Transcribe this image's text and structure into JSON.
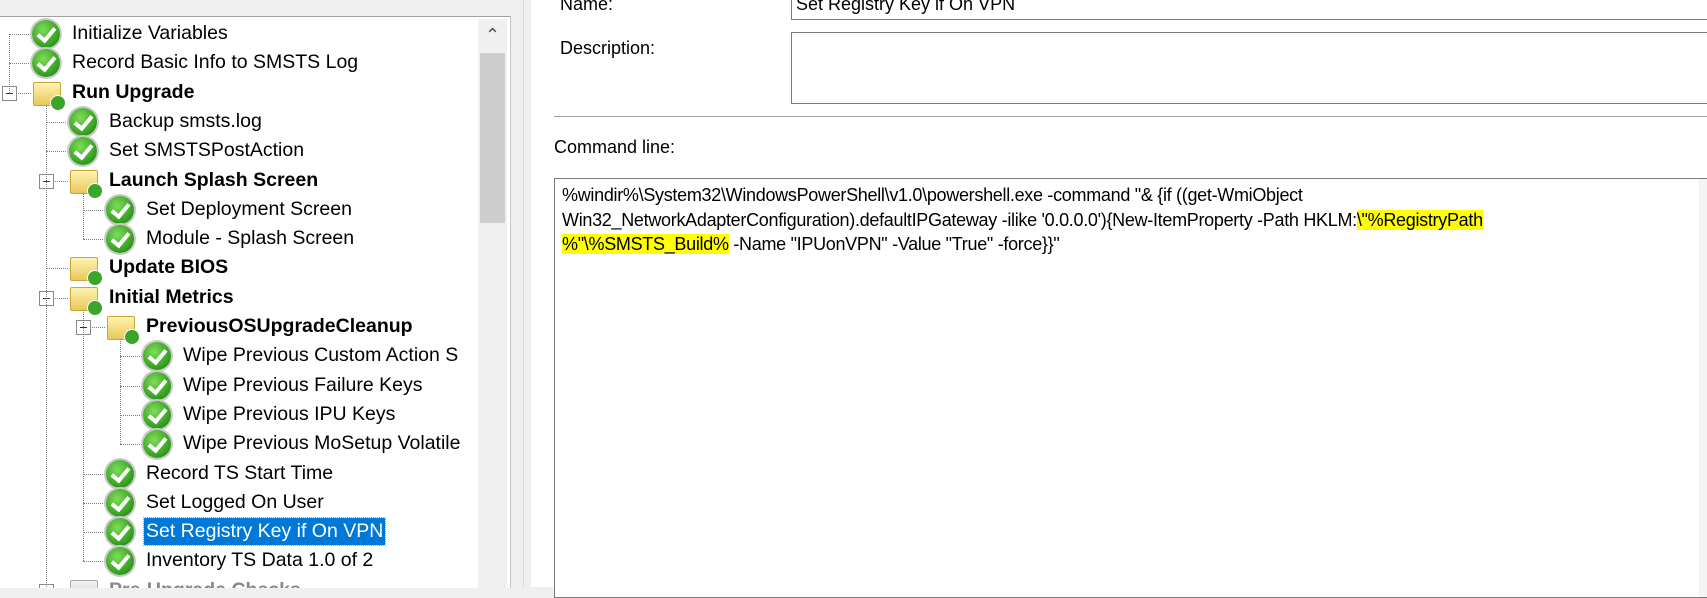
{
  "tree": {
    "items": [
      {
        "label": "Initialize Variables",
        "level": 0,
        "type": "step"
      },
      {
        "label": "Record Basic Info to SMSTS Log",
        "level": 0,
        "type": "step"
      },
      {
        "label": "Run Upgrade",
        "level": 0,
        "type": "group",
        "expanded": true
      },
      {
        "label": "Backup smsts.log",
        "level": 1,
        "type": "step"
      },
      {
        "label": "Set SMSTSPostAction",
        "level": 1,
        "type": "step"
      },
      {
        "label": "Launch Splash Screen",
        "level": 1,
        "type": "group",
        "expanded": true
      },
      {
        "label": "Set Deployment Screen",
        "level": 2,
        "type": "step"
      },
      {
        "label": "Module - Splash Screen",
        "level": 2,
        "type": "step"
      },
      {
        "label": "Update BIOS",
        "level": 1,
        "type": "group",
        "expanded": false
      },
      {
        "label": "Initial Metrics",
        "level": 1,
        "type": "group",
        "expanded": true
      },
      {
        "label": "PreviousOSUpgradeCleanup",
        "level": 2,
        "type": "group",
        "expanded": true
      },
      {
        "label": "Wipe Previous Custom Action S",
        "level": 3,
        "type": "step"
      },
      {
        "label": "Wipe Previous Failure Keys",
        "level": 3,
        "type": "step"
      },
      {
        "label": "Wipe Previous IPU Keys",
        "level": 3,
        "type": "step"
      },
      {
        "label": "Wipe Previous MoSetup Volatile",
        "level": 3,
        "type": "step"
      },
      {
        "label": "Record TS Start Time",
        "level": 2,
        "type": "step"
      },
      {
        "label": "Set Logged On User",
        "level": 2,
        "type": "step"
      },
      {
        "label": "Set Registry Key if On VPN",
        "level": 2,
        "type": "step",
        "selected": true
      },
      {
        "label": "Inventory TS Data 1.0 of 2",
        "level": 2,
        "type": "step"
      },
      {
        "label": "Pre-Upgrade Checks",
        "level": 1,
        "type": "group",
        "expanded": true,
        "disabled": true
      }
    ]
  },
  "properties": {
    "name_label": "Name:",
    "name_value": "Set Registry Key if On VPN",
    "description_label": "Description:",
    "description_value": "",
    "command_line_label": "Command line:",
    "command_line": {
      "line1": "%windir%\\System32\\WindowsPowerShell\\v1.0\\powershell.exe -command \"& {if ((get-WmiObject",
      "line2_plain": "Win32_NetworkAdapterConfiguration).defaultIPGateway -ilike '0.0.0.0'){New-ItemProperty -Path HKLM:",
      "line2_highlight": "\\\"%RegistryPath",
      "line3_highlight": "%\"\\%SMSTS_Build%",
      "line3_plain": " -Name \"IPUonVPN\" -Value \"True\" -force}}\""
    },
    "highlight_color": "#ffff00",
    "selection_color": "#0078d7"
  }
}
